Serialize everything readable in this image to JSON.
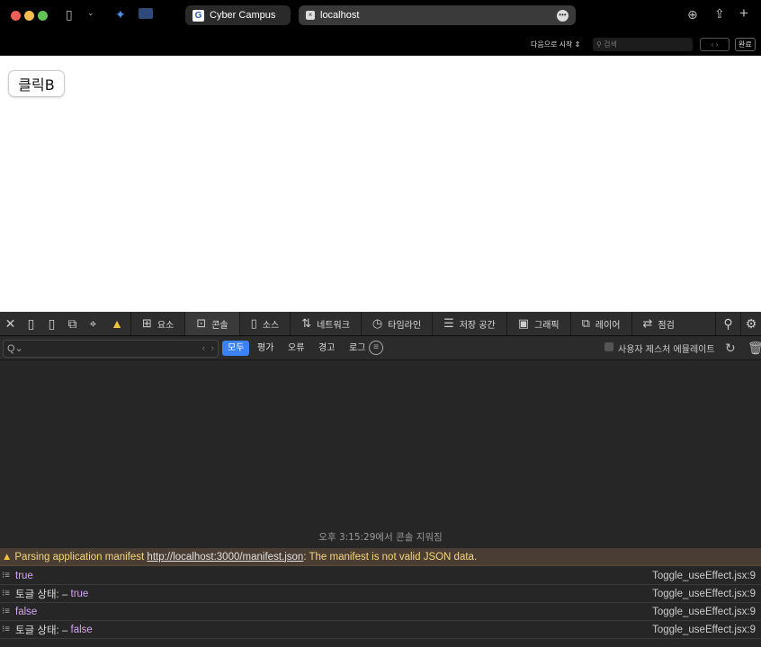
{
  "browser": {
    "tabs": [
      {
        "label": "Cyber Campus"
      },
      {
        "label": "localhost"
      }
    ],
    "find": {
      "mode": "다음으로 시작",
      "placeholder": "검색",
      "done": "완료"
    }
  },
  "page": {
    "button_label": "클릭B"
  },
  "devtools": {
    "tabs": [
      {
        "label": "요소",
        "icon": "elements-icon"
      },
      {
        "label": "콘솔",
        "icon": "console-icon"
      },
      {
        "label": "소스",
        "icon": "source-icon"
      },
      {
        "label": "네트워크",
        "icon": "network-icon"
      },
      {
        "label": "타임라인",
        "icon": "timeline-icon"
      },
      {
        "label": "저장 공간",
        "icon": "storage-icon"
      },
      {
        "label": "그래픽",
        "icon": "graphics-icon"
      },
      {
        "label": "레이어",
        "icon": "layers-icon"
      },
      {
        "label": "점검",
        "icon": "audit-icon"
      }
    ],
    "selected_tab": "콘솔",
    "filter": {
      "placeholder": "Q⌄",
      "levels": [
        "모두",
        "평가",
        "오류",
        "경고",
        "로그"
      ],
      "selected_level": "모두",
      "gesture_label": "사용자 제스처 에뮬레이트"
    },
    "console": {
      "cleared": "오후 3:15:29에서 콘솔 지워짐",
      "warning": {
        "prefix": "Parsing application manifest ",
        "link": "http://localhost:3000/manifest.json",
        "suffix": ": The manifest is not valid JSON data."
      },
      "logs": [
        {
          "label": "",
          "value": "true",
          "source": "Toggle_useEffect.jsx:9"
        },
        {
          "label": "토글 상태: – ",
          "value": "true",
          "source": "Toggle_useEffect.jsx:9"
        },
        {
          "label": "",
          "value": "false",
          "source": "Toggle_useEffect.jsx:9"
        },
        {
          "label": "토글 상태: – ",
          "value": "false",
          "source": "Toggle_useEffect.jsx:9"
        }
      ]
    }
  }
}
